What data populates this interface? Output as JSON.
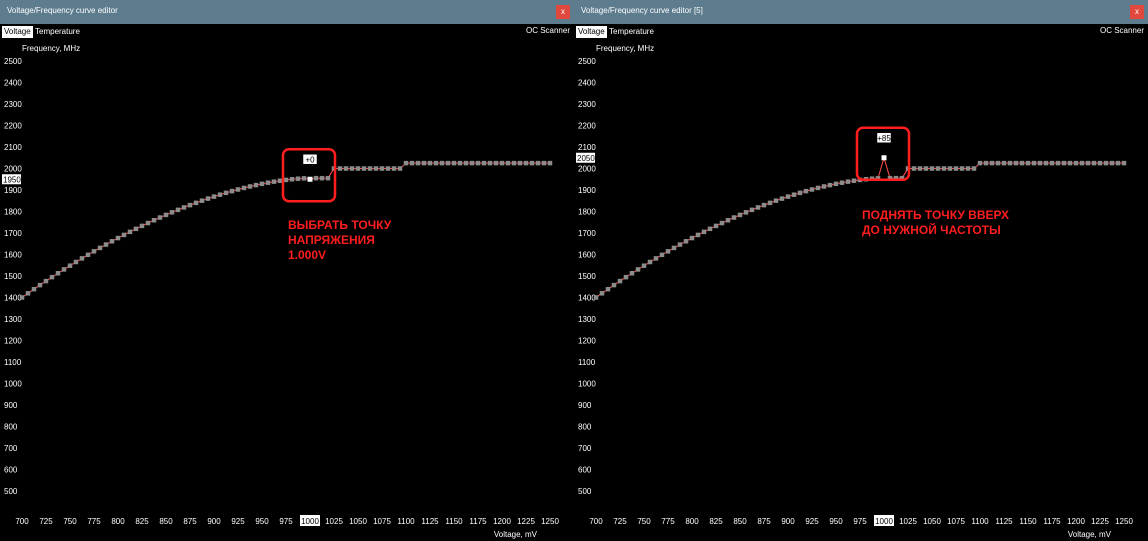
{
  "panels": [
    {
      "title": "Voltage/Frequency curve editor",
      "close_label": "x",
      "tabs": [
        {
          "label": "Voltage",
          "active": true
        },
        {
          "label": "Temperature",
          "active": false
        }
      ],
      "oc_scanner_label": "OC Scanner",
      "annotation": "ВЫБРАТЬ ТОЧКУ\nНАПРЯЖЕНИЯ\n1.000V",
      "chart_data": {
        "type": "scatter",
        "ylabel": "Frequency, MHz",
        "xlabel": "Voltage, mV",
        "xlim": [
          700,
          1250
        ],
        "ylim": [
          500,
          2500
        ],
        "x_ticks": [
          700,
          725,
          750,
          775,
          800,
          825,
          850,
          875,
          900,
          925,
          950,
          975,
          1000,
          1025,
          1050,
          1075,
          1100,
          1125,
          1150,
          1175,
          1200,
          1225,
          1250
        ],
        "y_ticks": [
          500,
          600,
          700,
          800,
          900,
          1000,
          1100,
          1200,
          1300,
          1400,
          1500,
          1600,
          1700,
          1800,
          1900,
          2000,
          2100,
          2200,
          2300,
          2400,
          2500
        ],
        "highlighted_x_tick": "1000",
        "highlighted_y_label": "1950",
        "offset_label": "+0",
        "selected_point": {
          "x": 1000,
          "y": 1950
        },
        "grid": false,
        "curve_color": "#ff4d4d",
        "point_color": "#8c8c8c"
      }
    },
    {
      "title": "Voltage/Frequency curve editor [5]",
      "close_label": "x",
      "tabs": [
        {
          "label": "Voltage",
          "active": true
        },
        {
          "label": "Temperature",
          "active": false
        }
      ],
      "oc_scanner_label": "OC Scanner",
      "annotation": "ПОДНЯТЬ ТОЧКУ ВВЕРХ\nДО НУЖНОЙ ЧАСТОТЫ",
      "chart_data": {
        "type": "scatter",
        "ylabel": "Frequency, MHz",
        "xlabel": "Voltage, mV",
        "xlim": [
          700,
          1250
        ],
        "ylim": [
          500,
          2500
        ],
        "x_ticks": [
          700,
          725,
          750,
          775,
          800,
          825,
          850,
          875,
          900,
          925,
          950,
          975,
          1000,
          1025,
          1050,
          1075,
          1100,
          1125,
          1150,
          1175,
          1200,
          1225,
          1250
        ],
        "y_ticks": [
          500,
          600,
          700,
          800,
          900,
          1000,
          1100,
          1200,
          1300,
          1400,
          1500,
          1600,
          1700,
          1800,
          1900,
          2000,
          2100,
          2200,
          2300,
          2400,
          2500
        ],
        "highlighted_x_tick": "1000",
        "highlighted_y_label": "2050",
        "offset_label": "+85",
        "selected_point": {
          "x": 1000,
          "y": 2050
        },
        "grid": false,
        "curve_color": "#ff4d4d",
        "point_color": "#8c8c8c"
      }
    }
  ]
}
